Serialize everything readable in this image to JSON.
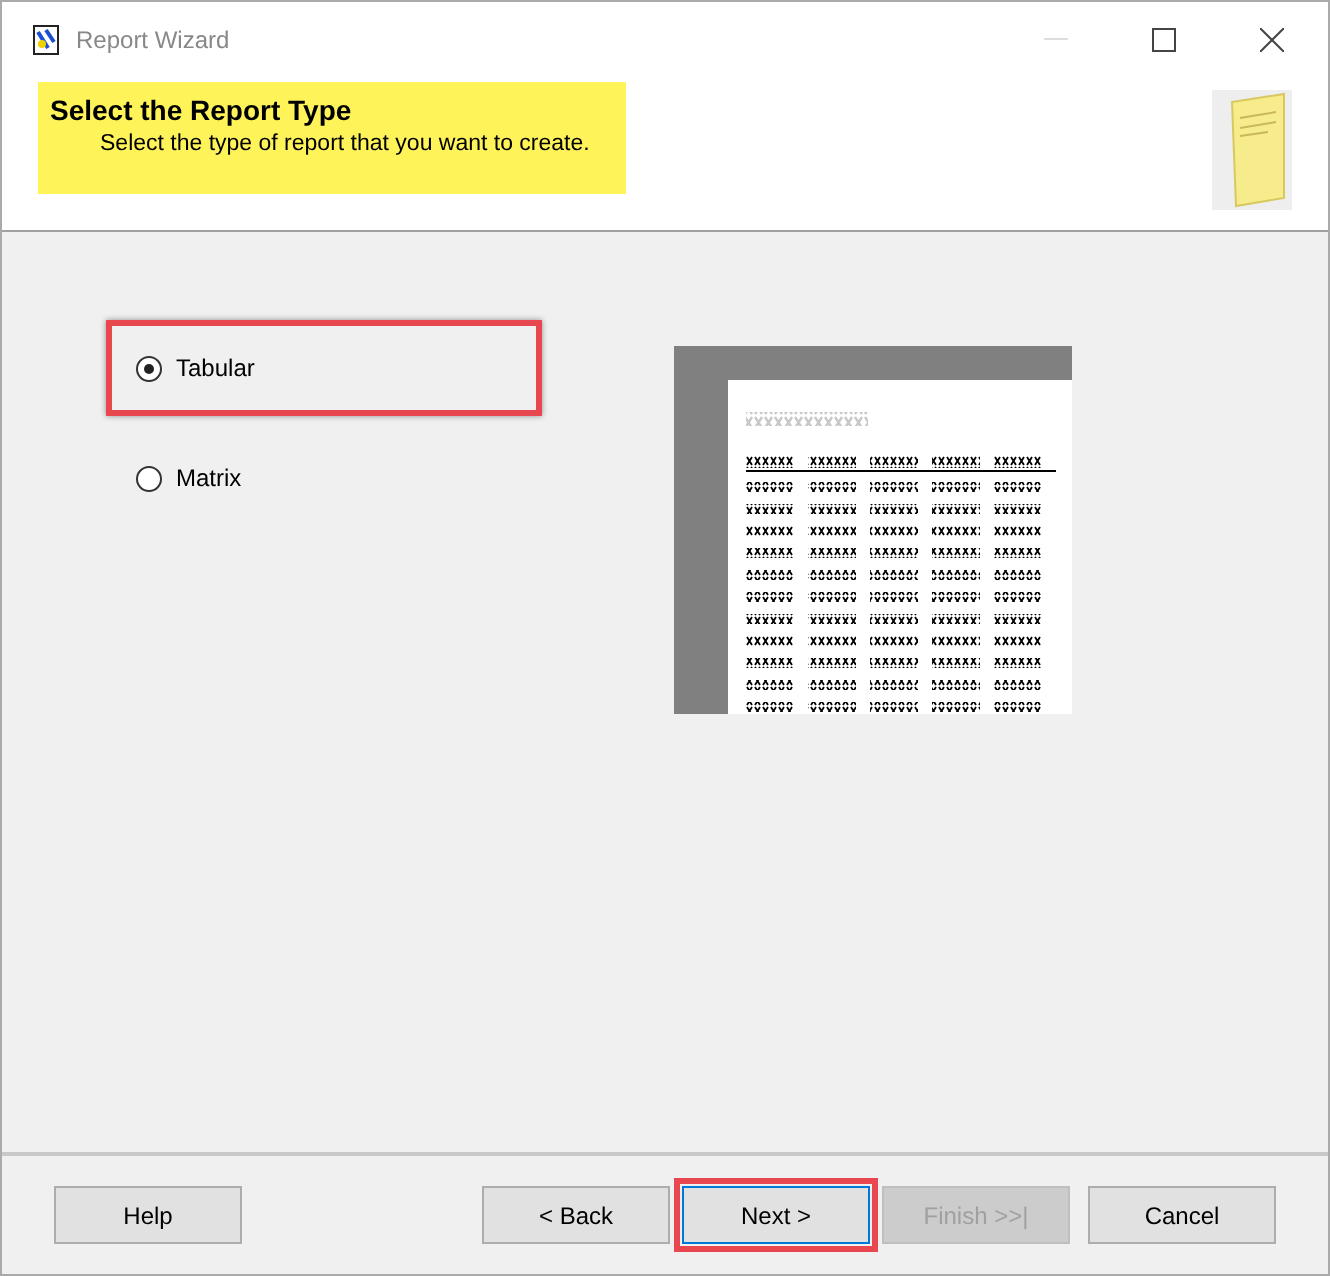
{
  "window": {
    "title": "Report Wizard"
  },
  "header": {
    "title": "Select the Report Type",
    "subtitle": "Select the type of report that you want to create."
  },
  "options": [
    {
      "label": "Tabular",
      "selected": true,
      "highlighted": true
    },
    {
      "label": "Matrix",
      "selected": false,
      "highlighted": false
    }
  ],
  "buttons": [
    {
      "label": "Help",
      "disabled": false,
      "highlighted": false
    },
    {
      "label": "< Back",
      "disabled": false,
      "highlighted": false
    },
    {
      "label": "Next >",
      "disabled": false,
      "highlighted": true
    },
    {
      "label": "Finish >>|",
      "disabled": true,
      "highlighted": false
    },
    {
      "label": "Cancel",
      "disabled": false,
      "highlighted": false
    }
  ]
}
